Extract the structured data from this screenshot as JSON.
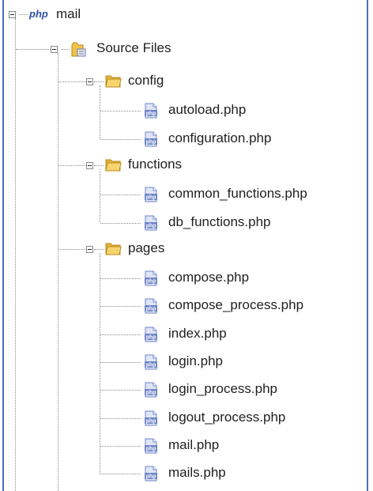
{
  "project": {
    "name": "mail",
    "icon": "php-project-icon",
    "badge": "php"
  },
  "source_files": {
    "label": "Source Files",
    "icon": "source-folder-icon"
  },
  "folders": [
    {
      "label": "config",
      "icon": "folder-icon",
      "files": [
        "autoload.php",
        "configuration.php"
      ]
    },
    {
      "label": "functions",
      "icon": "folder-icon",
      "files": [
        "common_functions.php",
        "db_functions.php"
      ]
    },
    {
      "label": "pages",
      "icon": "folder-icon",
      "files": [
        "compose.php",
        "compose_process.php",
        "index.php",
        "login.php",
        "login_process.php",
        "logout_process.php",
        "mail.php",
        "mails.php"
      ]
    }
  ],
  "file_icon": "php-file-icon",
  "file_badge": "php",
  "colors": {
    "border": "#4a6fb5",
    "folder": "#f0c24a",
    "php_file_icon": "#6f86c7"
  }
}
